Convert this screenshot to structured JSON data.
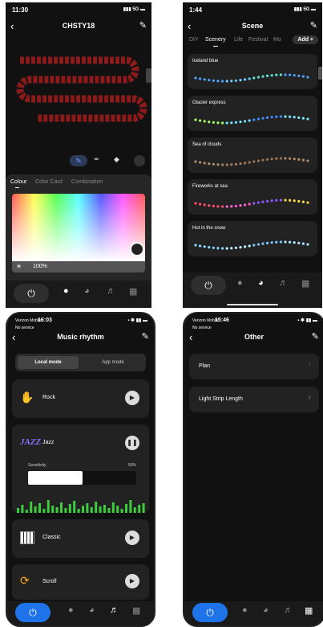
{
  "screen1": {
    "time": "11:30",
    "signal": "5G",
    "title": "CHSTY18",
    "tabs": [
      "Colour",
      "Color Card",
      "Combination"
    ],
    "brightness": "100%"
  },
  "screen2": {
    "time": "1:44",
    "signal": "5G",
    "title": "Scene",
    "tabs": [
      "DIY",
      "Scenery",
      "Life",
      "Festival",
      "Mo"
    ],
    "add_label": "Add +",
    "scenes": [
      {
        "name": "Iceland blue",
        "colors": [
          "#4fa3ff",
          "#6ec9ff",
          "#60e0d0",
          "#4fa3ff"
        ]
      },
      {
        "name": "Glacier express",
        "colors": [
          "#9fff6a",
          "#6ee0ff",
          "#3f8cff",
          "#7fe8ff"
        ]
      },
      {
        "name": "Sea of clouds",
        "colors": [
          "#b08a6a",
          "#a07a5a",
          "#9a7555",
          "#b08a6a"
        ]
      },
      {
        "name": "Fireworks at sea",
        "colors": [
          "#ff4d6a",
          "#ff5fd0",
          "#8f5bff",
          "#ffd84a"
        ]
      },
      {
        "name": "Hut in the snow",
        "colors": [
          "#8ad8ff",
          "#c0eeff",
          "#7fc8ff",
          "#b0e8ff"
        ]
      }
    ]
  },
  "screen3": {
    "carrier": "Verizon Mobile",
    "carrier_sub": "No service",
    "time": "16:03",
    "title": "Music rhythm",
    "mode_tabs": [
      "Local mode",
      "App mode"
    ],
    "songs": [
      {
        "name": "Rock",
        "state": "play"
      },
      {
        "name": "Jazz",
        "state": "pause"
      },
      {
        "name": "Classic",
        "state": "play"
      },
      {
        "name": "Scroll",
        "state": "play"
      }
    ],
    "sensitivity_label": "Sensitivity",
    "sensitivity_value": "50%",
    "sensitivity_level": 0.5
  },
  "screen4": {
    "carrier": "Verizon Mobile",
    "carrier_sub": "No service",
    "time": "15:46",
    "title": "Other",
    "items": [
      "Plan",
      "Light Strip Length"
    ]
  },
  "colors": {
    "accent_blue": "#1f73e8",
    "strip_red": "#8b1a1a",
    "eq_green": "#3ecb3e"
  }
}
